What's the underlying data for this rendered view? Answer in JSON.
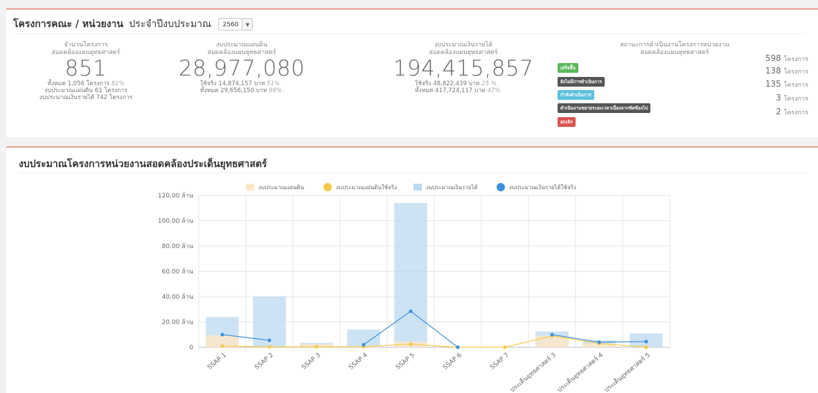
{
  "header": {
    "title": "โครงการคณะ / หน่วยงาน",
    "subtitle": "ประจำปีงบประมาณ",
    "year": "2560"
  },
  "stats": {
    "count": {
      "label1": "จำนวนโครงการ",
      "label2": "สอดคล้องแผนยุทธศาสตร์",
      "value": "851",
      "line1": "ทั้งหมด 1,056 โครงการ",
      "line1_pct": "81%",
      "line2": "งบประมาณแผ่นดิน 61 โครงการ",
      "line3": "งบประมาณเงินรายได้ 742 โครงการ"
    },
    "land": {
      "label1": "งบประมาณแผ่นดิน",
      "label2": "สอดคล้องแผนยุทธศาสตร์",
      "value": "28,977,080",
      "line1": "ใช้จริง 14,874,157 บาท",
      "line1_pct": "51%",
      "line2": "ทั้งหมด 29,656,150 บาท",
      "line2_pct": "98%"
    },
    "income": {
      "label1": "งบประมาณเงินรายได้",
      "label2": "สอดคล้องแผนยุทธศาสตร์",
      "value": "194,415,857",
      "line1": "ใช้จริง 48,822,439 บาท",
      "line1_pct": "25 %",
      "line2": "ทั้งหมด 417,724,117 บาท",
      "line2_pct": "47%"
    }
  },
  "status": {
    "title1": "สถานะการดำเนินงานโครงการหน่วยงาน",
    "title2": "สอดคล้องแผนยุทธศาสตร์",
    "unit": "โครงการ",
    "items": [
      {
        "label": "เสร็จสิ้น",
        "count": "598",
        "color": "#5cb85c"
      },
      {
        "label": "ยังไม่มีการดำเนินการ",
        "count": "138",
        "color": "#555555"
      },
      {
        "label": "กำลังดำเนินการ",
        "count": "135",
        "color": "#5bc0de"
      },
      {
        "label": "ดำเนินงานขยายระยะเวลาเนื่องจากขัดข้องไป",
        "count": "3",
        "color": "#555555"
      },
      {
        "label": "ยกเลิก",
        "count": "2",
        "color": "#d9534f"
      }
    ]
  },
  "chart_section": {
    "title": "งบประมาณโครงการหน่วยงานสอดคล้องประเด็นยุทธศาสตร์"
  },
  "chart_data": {
    "type": "bar",
    "categories": [
      "SSAP 1",
      "SSAP 2",
      "SSAP 3",
      "SSAP 4",
      "SSAP 5",
      "SSAP 6",
      "SSAP 7",
      "ประเด็นยุทธศาสตร์ 3",
      "ประเด็นยุทธศาสตร์ 4",
      "ประเด็นยุทธศาสตร์ 5"
    ],
    "yunit": "ล้าน",
    "ylim": [
      0,
      120
    ],
    "yticks": [
      "0",
      "20.00 ล้าน",
      "40.00 ล้าน",
      "60.00 ล้าน",
      "80.00 ล้าน",
      "100.00 ล้าน",
      "120.00 ล้าน"
    ],
    "series": [
      {
        "name": "งบประมาณแผ่นดิน",
        "kind": "bar",
        "color": "#fbe8c8",
        "values": [
          9.5,
          0.5,
          2.5,
          1.0,
          4.5,
          0.0,
          0.0,
          9.0,
          3.0,
          0.0
        ]
      },
      {
        "name": "งบประมาณแผ่นดินใช้จริง",
        "kind": "line",
        "color": "#f7c948",
        "values": [
          1.0,
          0.3,
          0.3,
          0.5,
          2.5,
          0.0,
          0.0,
          9.0,
          3.0,
          0.0
        ]
      },
      {
        "name": "งบประมาณเงินรายได้",
        "kind": "bar",
        "color": "#bcd9f0",
        "values": [
          24.0,
          40.0,
          3.5,
          14.0,
          114.0,
          0.0,
          0.0,
          12.5,
          5.5,
          11.0
        ]
      },
      {
        "name": "งบประมาณเงินรายได้ใช้จริง",
        "kind": "line",
        "color": "#3c91dc",
        "values": [
          10.0,
          5.5,
          null,
          2.0,
          28.5,
          0.0,
          null,
          10.0,
          4.0,
          4.5
        ]
      }
    ],
    "grid": true,
    "legend": "top-center"
  }
}
